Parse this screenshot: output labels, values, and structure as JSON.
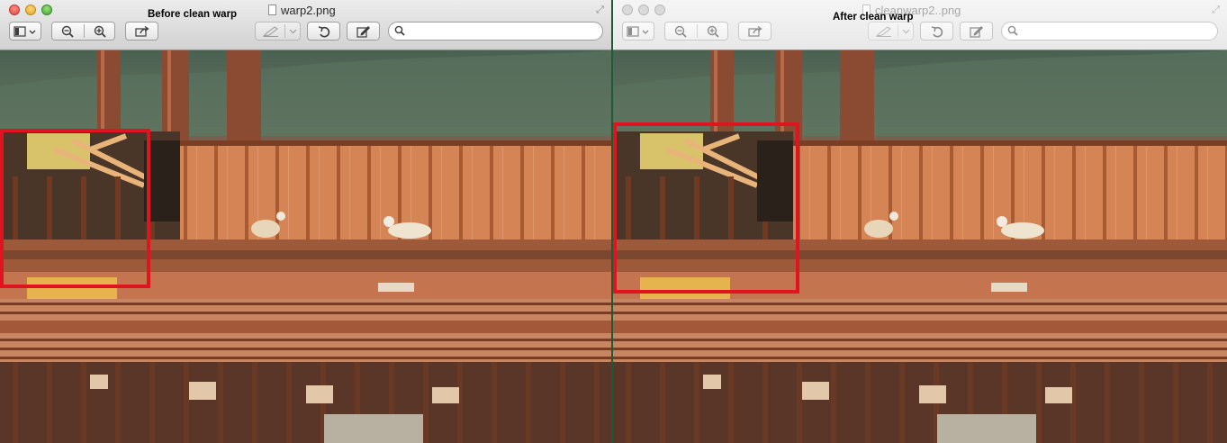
{
  "windows": {
    "left": {
      "overlay_label": "Before clean warp",
      "document_title": "warp2.png",
      "search_placeholder": "",
      "traffic_lights": [
        "close",
        "minimize",
        "zoom"
      ]
    },
    "right": {
      "overlay_label": "After clean warp",
      "document_title": "cleanwarp2..png",
      "search_placeholder": "",
      "traffic_lights": [
        "close",
        "minimize",
        "zoom"
      ]
    }
  },
  "toolbar": {
    "icons": [
      "sidebar-icon",
      "chevron-down-icon",
      "zoom-out-icon",
      "zoom-in-icon",
      "share-icon",
      "markup-pen-icon",
      "rotate-icon",
      "edit-icon",
      "search-icon"
    ]
  },
  "colors": {
    "highlight_box": "#e0141e",
    "divider": "#1d5a35",
    "scaffold_wood": "#d07a4a",
    "hillside": "#4e6a58"
  }
}
